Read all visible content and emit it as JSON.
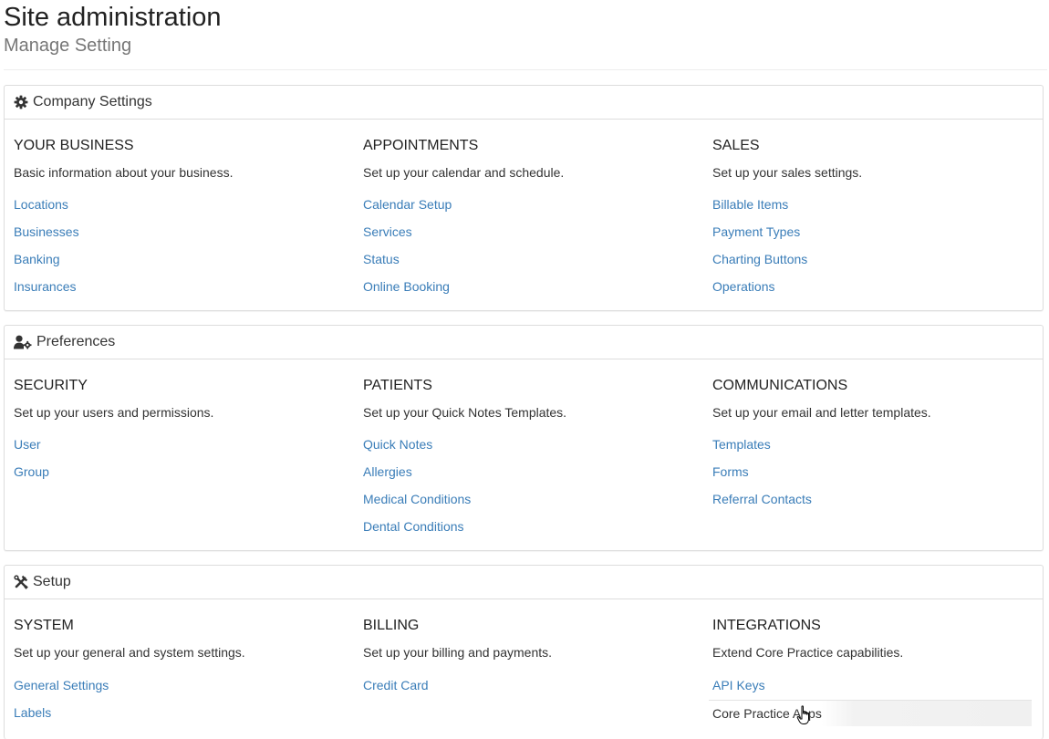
{
  "header": {
    "title": "Site administration",
    "subtitle": "Manage Setting"
  },
  "panels": [
    {
      "title": "Company Settings",
      "icon": "gear-icon",
      "columns": [
        {
          "title": "YOUR BUSINESS",
          "description": "Basic information about your business.",
          "links": [
            "Locations",
            "Businesses",
            "Banking",
            "Insurances"
          ]
        },
        {
          "title": "APPOINTMENTS",
          "description": "Set up your calendar and schedule.",
          "links": [
            "Calendar Setup",
            "Services",
            "Status",
            "Online Booking"
          ]
        },
        {
          "title": "SALES",
          "description": "Set up your sales settings.",
          "links": [
            "Billable Items",
            "Payment Types",
            "Charting Buttons",
            "Operations"
          ]
        }
      ]
    },
    {
      "title": "Preferences",
      "icon": "user-gear-icon",
      "columns": [
        {
          "title": "SECURITY",
          "description": "Set up your users and permissions.",
          "links": [
            "User",
            "Group"
          ]
        },
        {
          "title": "PATIENTS",
          "description": "Set up your Quick Notes Templates.",
          "links": [
            "Quick Notes",
            "Allergies",
            "Medical Conditions",
            "Dental Conditions"
          ]
        },
        {
          "title": "COMMUNICATIONS",
          "description": "Set up your email and letter templates.",
          "links": [
            "Templates",
            "Forms",
            "Referral Contacts"
          ]
        }
      ]
    },
    {
      "title": "Setup",
      "icon": "wrench-screwdriver-icon",
      "columns": [
        {
          "title": "SYSTEM",
          "description": "Set up your general and system settings.",
          "links": [
            "General Settings",
            "Labels"
          ]
        },
        {
          "title": "BILLING",
          "description": "Set up your billing and payments.",
          "links": [
            "Credit Card"
          ]
        },
        {
          "title": "INTEGRATIONS",
          "description": "Extend Core Practice capabilities.",
          "links": [
            "API Keys",
            "Core Practice Apps"
          ]
        }
      ]
    }
  ],
  "colors": {
    "link": "#3a7db8",
    "border": "#dddddd",
    "subtitle": "#777777"
  }
}
